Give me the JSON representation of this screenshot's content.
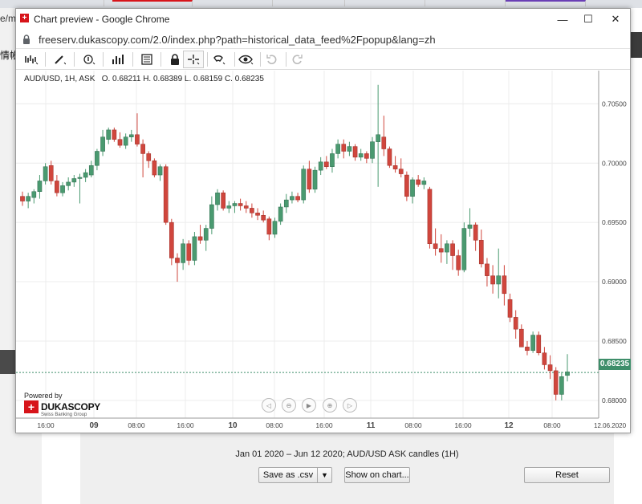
{
  "background": {
    "url_fragment": "e/m",
    "cn_fragment": "情帳",
    "caption": "Jan 01 2020 – Jun 12 2020; AUD/USD ASK candles (1H)",
    "save_button": "Save as .csv",
    "show_button": "Show on chart...",
    "reset_button": "Reset"
  },
  "window": {
    "title": "Chart preview - Google Chrome",
    "url": "freeserv.dukascopy.com/2.0/index.php?path=historical_data_feed%2Fpopup&lang=zh",
    "minimize": "—",
    "maximize": "☐",
    "close": "✕"
  },
  "chart": {
    "ohlc_label": "AUD/USD, 1H, ASK   O. 0.68211 H. 0.68389 L. 0.68159 C. 0.68235",
    "current_price_label": "0.68235",
    "powered_by": "Powered by",
    "brand_name": "DUKASCOPY",
    "brand_sub": "Swiss Banking Group",
    "colors": {
      "up": "#4a9a70",
      "down": "#d0463d",
      "grid": "#ececec",
      "price_line": "#3e8e6a"
    }
  },
  "chart_data": {
    "type": "candlestick",
    "title": "",
    "symbol": "AUD/USD",
    "timeframe": "1H",
    "side": "ASK",
    "last_candle": {
      "open": 0.68211,
      "high": 0.68389,
      "low": 0.68159,
      "close": 0.68235
    },
    "current_price": 0.68235,
    "y_ticks": [
      0.705,
      0.7,
      0.695,
      0.69,
      0.685,
      0.68
    ],
    "ylim": [
      0.6785,
      0.7078
    ],
    "x_tick_labels": [
      "16:00",
      "09",
      "08:00",
      "16:00",
      "10",
      "08:00",
      "16:00",
      "11",
      "08:00",
      "16:00",
      "12",
      "08:00"
    ],
    "x_end_label": "12.06.2020",
    "grid": true,
    "candles": [
      {
        "o": 0.6972,
        "h": 0.6976,
        "l": 0.6964,
        "c": 0.6968
      },
      {
        "o": 0.6968,
        "h": 0.6975,
        "l": 0.6962,
        "c": 0.6972
      },
      {
        "o": 0.6971,
        "h": 0.6978,
        "l": 0.6966,
        "c": 0.6976
      },
      {
        "o": 0.6976,
        "h": 0.699,
        "l": 0.697,
        "c": 0.6985
      },
      {
        "o": 0.6985,
        "h": 0.7,
        "l": 0.6982,
        "c": 0.6997
      },
      {
        "o": 0.6998,
        "h": 0.7002,
        "l": 0.6982,
        "c": 0.6985
      },
      {
        "o": 0.6985,
        "h": 0.699,
        "l": 0.6972,
        "c": 0.6975
      },
      {
        "o": 0.6975,
        "h": 0.6984,
        "l": 0.6972,
        "c": 0.6981
      },
      {
        "o": 0.6981,
        "h": 0.6988,
        "l": 0.6977,
        "c": 0.6984
      },
      {
        "o": 0.6984,
        "h": 0.699,
        "l": 0.698,
        "c": 0.6987
      },
      {
        "o": 0.6987,
        "h": 0.6991,
        "l": 0.6966,
        "c": 0.6988
      },
      {
        "o": 0.6988,
        "h": 0.6995,
        "l": 0.6984,
        "c": 0.6992
      },
      {
        "o": 0.699,
        "h": 0.7002,
        "l": 0.6988,
        "c": 0.6998
      },
      {
        "o": 0.6998,
        "h": 0.7012,
        "l": 0.6994,
        "c": 0.701
      },
      {
        "o": 0.701,
        "h": 0.7028,
        "l": 0.7006,
        "c": 0.7022
      },
      {
        "o": 0.702,
        "h": 0.703,
        "l": 0.7016,
        "c": 0.7028
      },
      {
        "o": 0.7028,
        "h": 0.703,
        "l": 0.7018,
        "c": 0.702
      },
      {
        "o": 0.702,
        "h": 0.7026,
        "l": 0.7013,
        "c": 0.7015
      },
      {
        "o": 0.7015,
        "h": 0.7025,
        "l": 0.7012,
        "c": 0.7022
      },
      {
        "o": 0.7022,
        "h": 0.7028,
        "l": 0.7018,
        "c": 0.7024
      },
      {
        "o": 0.7024,
        "h": 0.7042,
        "l": 0.7014,
        "c": 0.7016
      },
      {
        "o": 0.7016,
        "h": 0.702,
        "l": 0.6988,
        "c": 0.7008
      },
      {
        "o": 0.7008,
        "h": 0.701,
        "l": 0.6996,
        "c": 0.7002
      },
      {
        "o": 0.7002,
        "h": 0.7004,
        "l": 0.6988,
        "c": 0.699
      },
      {
        "o": 0.699,
        "h": 0.6999,
        "l": 0.6985,
        "c": 0.6997
      },
      {
        "o": 0.6997,
        "h": 0.6999,
        "l": 0.6948,
        "c": 0.695
      },
      {
        "o": 0.695,
        "h": 0.6953,
        "l": 0.6914,
        "c": 0.692
      },
      {
        "o": 0.692,
        "h": 0.6924,
        "l": 0.69,
        "c": 0.6916
      },
      {
        "o": 0.6916,
        "h": 0.6936,
        "l": 0.691,
        "c": 0.6932
      },
      {
        "o": 0.6932,
        "h": 0.6935,
        "l": 0.6914,
        "c": 0.6918
      },
      {
        "o": 0.6918,
        "h": 0.6942,
        "l": 0.6914,
        "c": 0.6938
      },
      {
        "o": 0.6938,
        "h": 0.6948,
        "l": 0.6932,
        "c": 0.6935
      },
      {
        "o": 0.6935,
        "h": 0.6948,
        "l": 0.6926,
        "c": 0.6945
      },
      {
        "o": 0.6945,
        "h": 0.6972,
        "l": 0.694,
        "c": 0.6965
      },
      {
        "o": 0.6965,
        "h": 0.6978,
        "l": 0.696,
        "c": 0.6975
      },
      {
        "o": 0.6975,
        "h": 0.6977,
        "l": 0.696,
        "c": 0.6962
      },
      {
        "o": 0.6962,
        "h": 0.6968,
        "l": 0.6958,
        "c": 0.6964
      },
      {
        "o": 0.6964,
        "h": 0.6968,
        "l": 0.6958,
        "c": 0.6966
      },
      {
        "o": 0.6966,
        "h": 0.697,
        "l": 0.696,
        "c": 0.6964
      },
      {
        "o": 0.6964,
        "h": 0.6968,
        "l": 0.6958,
        "c": 0.6962
      },
      {
        "o": 0.6962,
        "h": 0.6966,
        "l": 0.6954,
        "c": 0.6958
      },
      {
        "o": 0.6958,
        "h": 0.6962,
        "l": 0.6952,
        "c": 0.6956
      },
      {
        "o": 0.6956,
        "h": 0.696,
        "l": 0.695,
        "c": 0.6952
      },
      {
        "o": 0.6953,
        "h": 0.6955,
        "l": 0.6935,
        "c": 0.694
      },
      {
        "o": 0.694,
        "h": 0.6954,
        "l": 0.6937,
        "c": 0.6951
      },
      {
        "o": 0.6951,
        "h": 0.6966,
        "l": 0.6948,
        "c": 0.6963
      },
      {
        "o": 0.6963,
        "h": 0.6974,
        "l": 0.6958,
        "c": 0.6969
      },
      {
        "o": 0.6969,
        "h": 0.6976,
        "l": 0.6966,
        "c": 0.6972
      },
      {
        "o": 0.6972,
        "h": 0.6975,
        "l": 0.6967,
        "c": 0.6969
      },
      {
        "o": 0.6969,
        "h": 0.6998,
        "l": 0.6966,
        "c": 0.6995
      },
      {
        "o": 0.6995,
        "h": 0.7002,
        "l": 0.6975,
        "c": 0.6978
      },
      {
        "o": 0.6978,
        "h": 0.6997,
        "l": 0.6975,
        "c": 0.6994
      },
      {
        "o": 0.6994,
        "h": 0.7005,
        "l": 0.699,
        "c": 0.7001
      },
      {
        "o": 0.7001,
        "h": 0.7006,
        "l": 0.6995,
        "c": 0.6997
      },
      {
        "o": 0.6997,
        "h": 0.7012,
        "l": 0.6992,
        "c": 0.7008
      },
      {
        "o": 0.7008,
        "h": 0.702,
        "l": 0.7004,
        "c": 0.7016
      },
      {
        "o": 0.7016,
        "h": 0.702,
        "l": 0.7004,
        "c": 0.701
      },
      {
        "o": 0.701,
        "h": 0.7018,
        "l": 0.7006,
        "c": 0.7014
      },
      {
        "o": 0.7014,
        "h": 0.7016,
        "l": 0.7002,
        "c": 0.7005
      },
      {
        "o": 0.7005,
        "h": 0.7012,
        "l": 0.7002,
        "c": 0.7008
      },
      {
        "o": 0.7008,
        "h": 0.701,
        "l": 0.7,
        "c": 0.7004
      },
      {
        "o": 0.7004,
        "h": 0.7022,
        "l": 0.7,
        "c": 0.7018
      },
      {
        "o": 0.7018,
        "h": 0.7066,
        "l": 0.698,
        "c": 0.7024
      },
      {
        "o": 0.7022,
        "h": 0.704,
        "l": 0.7006,
        "c": 0.7012
      },
      {
        "o": 0.7012,
        "h": 0.7014,
        "l": 0.6996,
        "c": 0.6998
      },
      {
        "o": 0.6998,
        "h": 0.7006,
        "l": 0.6992,
        "c": 0.6995
      },
      {
        "o": 0.6995,
        "h": 0.7004,
        "l": 0.6988,
        "c": 0.6991
      },
      {
        "o": 0.699,
        "h": 0.6993,
        "l": 0.6968,
        "c": 0.6972
      },
      {
        "o": 0.6972,
        "h": 0.6988,
        "l": 0.6966,
        "c": 0.6986
      },
      {
        "o": 0.6986,
        "h": 0.699,
        "l": 0.698,
        "c": 0.6982
      },
      {
        "o": 0.6982,
        "h": 0.6988,
        "l": 0.6978,
        "c": 0.6985
      },
      {
        "o": 0.6978,
        "h": 0.698,
        "l": 0.6928,
        "c": 0.6932
      },
      {
        "o": 0.6932,
        "h": 0.6945,
        "l": 0.6922,
        "c": 0.6928
      },
      {
        "o": 0.6928,
        "h": 0.694,
        "l": 0.6916,
        "c": 0.6925
      },
      {
        "o": 0.6925,
        "h": 0.6935,
        "l": 0.6915,
        "c": 0.6932
      },
      {
        "o": 0.6932,
        "h": 0.6935,
        "l": 0.691,
        "c": 0.6922
      },
      {
        "o": 0.6922,
        "h": 0.6927,
        "l": 0.6905,
        "c": 0.691
      },
      {
        "o": 0.691,
        "h": 0.695,
        "l": 0.6908,
        "c": 0.6945
      },
      {
        "o": 0.6945,
        "h": 0.6962,
        "l": 0.6938,
        "c": 0.6948
      },
      {
        "o": 0.6948,
        "h": 0.695,
        "l": 0.6926,
        "c": 0.6935
      },
      {
        "o": 0.6935,
        "h": 0.6944,
        "l": 0.6912,
        "c": 0.6915
      },
      {
        "o": 0.6915,
        "h": 0.692,
        "l": 0.6896,
        "c": 0.6905
      },
      {
        "o": 0.6905,
        "h": 0.6914,
        "l": 0.689,
        "c": 0.6898
      },
      {
        "o": 0.6898,
        "h": 0.6928,
        "l": 0.6886,
        "c": 0.6905
      },
      {
        "o": 0.6905,
        "h": 0.6914,
        "l": 0.688,
        "c": 0.689
      },
      {
        "o": 0.6885,
        "h": 0.689,
        "l": 0.6866,
        "c": 0.687
      },
      {
        "o": 0.687,
        "h": 0.6876,
        "l": 0.6852,
        "c": 0.686
      },
      {
        "o": 0.686,
        "h": 0.6864,
        "l": 0.6846,
        "c": 0.6845
      },
      {
        "o": 0.6845,
        "h": 0.685,
        "l": 0.6838,
        "c": 0.6842
      },
      {
        "o": 0.6842,
        "h": 0.6858,
        "l": 0.684,
        "c": 0.6855
      },
      {
        "o": 0.6855,
        "h": 0.6858,
        "l": 0.6838,
        "c": 0.684
      },
      {
        "o": 0.684,
        "h": 0.6845,
        "l": 0.6826,
        "c": 0.683
      },
      {
        "o": 0.683,
        "h": 0.6838,
        "l": 0.6818,
        "c": 0.6825
      },
      {
        "o": 0.6825,
        "h": 0.6828,
        "l": 0.68,
        "c": 0.6805
      },
      {
        "o": 0.6805,
        "h": 0.6824,
        "l": 0.68,
        "c": 0.682
      },
      {
        "o": 0.6821,
        "h": 0.6839,
        "l": 0.6816,
        "c": 0.6824
      }
    ]
  }
}
